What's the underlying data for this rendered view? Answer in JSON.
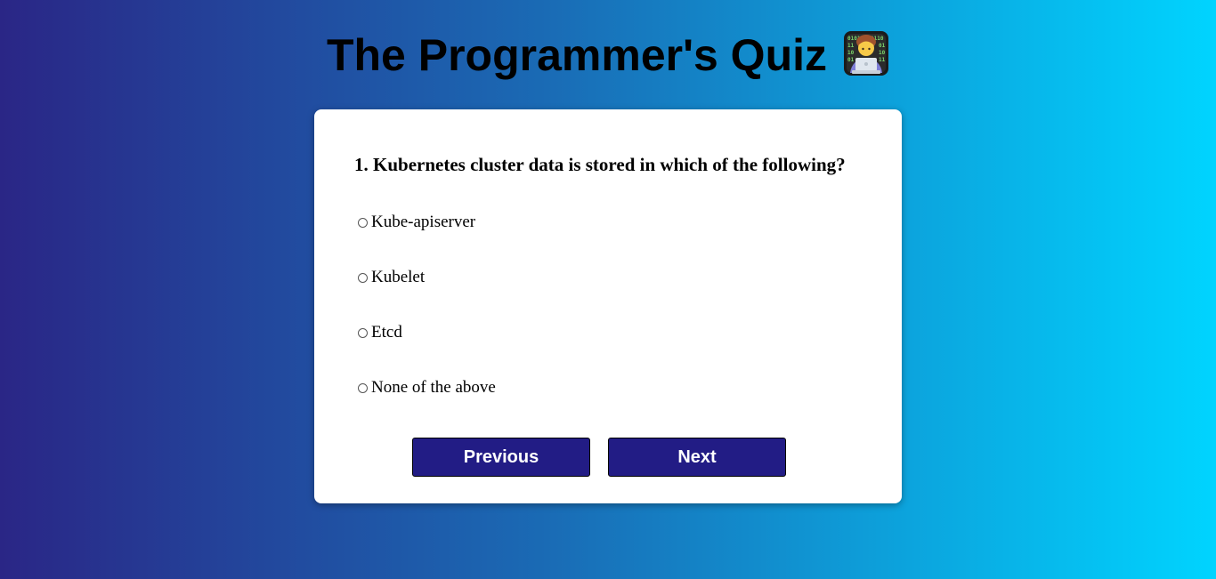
{
  "header": {
    "title": "The Programmer's Quiz",
    "title_icon": "technologist-emoji-icon"
  },
  "quiz": {
    "question": "1. Kubernetes cluster data is stored in which of the following?",
    "options": [
      {
        "label": "Kube-apiserver",
        "selected": false
      },
      {
        "label": "Kubelet",
        "selected": false
      },
      {
        "label": "Etcd",
        "selected": false
      },
      {
        "label": "None of the above",
        "selected": false
      }
    ],
    "buttons": {
      "previous_label": "Previous",
      "next_label": "Next"
    }
  },
  "colors": {
    "background_start": "#2a2686",
    "background_end": "#00d4ff",
    "button": "#221c85",
    "card": "#ffffff"
  }
}
